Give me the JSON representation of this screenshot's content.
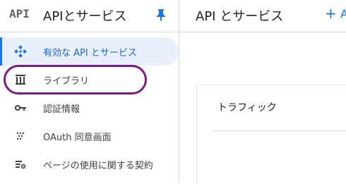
{
  "sidebar": {
    "logo_text": "API",
    "title": "APIとサービス",
    "items": [
      {
        "label": "有効な API とサービス",
        "icon": "enabled-apis-icon"
      },
      {
        "label": "ライブラリ",
        "icon": "library-icon"
      },
      {
        "label": "認証情報",
        "icon": "key-icon"
      },
      {
        "label": "OAuth 同意画面",
        "icon": "oauth-consent-icon"
      },
      {
        "label": "ページの使用に関する契約",
        "icon": "settings-list-icon"
      }
    ],
    "active_index": 0,
    "highlighted_index": 1
  },
  "main": {
    "title": "API とサービス",
    "enable_button": {
      "icon": "plus-icon",
      "label": "+",
      "label_text": "A"
    },
    "traffic_card": {
      "title": "トラフィック"
    }
  },
  "colors": {
    "accent": "#1a73e8",
    "active_bg": "#e8f0fe",
    "highlight_ring": "#7b1a7f"
  }
}
